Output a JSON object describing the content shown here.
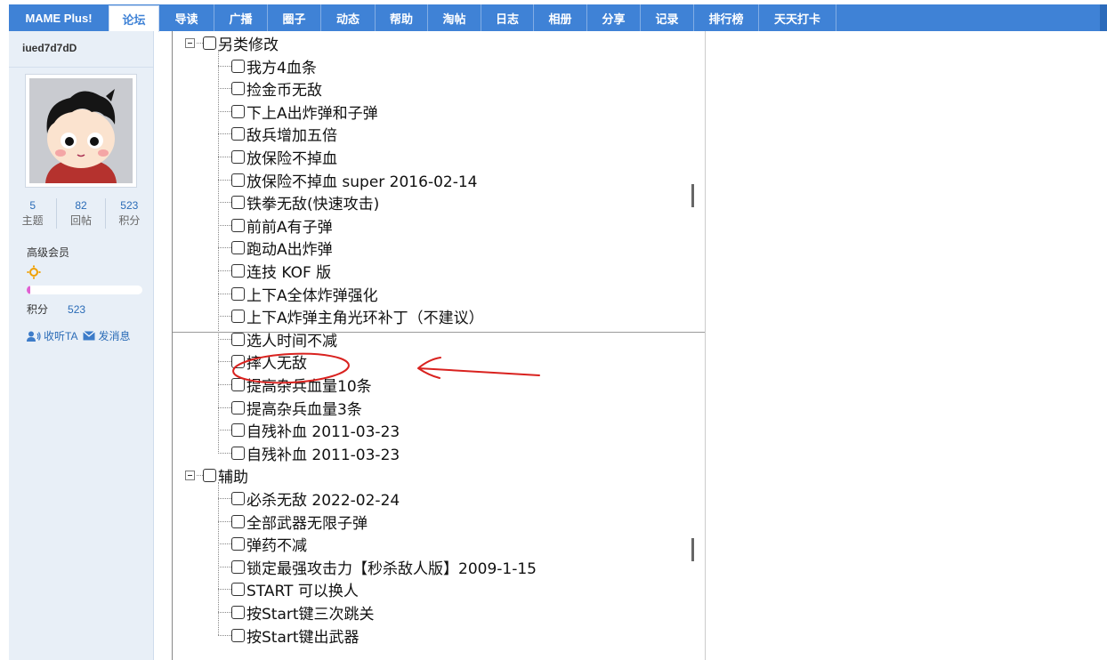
{
  "nav": {
    "brand": "MAME Plus!",
    "tabs": [
      {
        "label": "论坛",
        "active": true
      },
      {
        "label": "导读"
      },
      {
        "label": "广播"
      },
      {
        "label": "圈子"
      },
      {
        "label": "动态"
      },
      {
        "label": "帮助"
      },
      {
        "label": "淘帖"
      },
      {
        "label": "日志"
      },
      {
        "label": "相册"
      },
      {
        "label": "分享"
      },
      {
        "label": "记录"
      },
      {
        "label": "排行榜"
      },
      {
        "label": "天天打卡"
      }
    ]
  },
  "profile": {
    "username": "iued7d7dD",
    "stats": [
      {
        "value": "5",
        "label": "主题"
      },
      {
        "value": "82",
        "label": "回帖"
      },
      {
        "value": "523",
        "label": "积分"
      }
    ],
    "grade": "高级会员",
    "grade_icon": "sun-icon",
    "progress": 0.03,
    "points_label": "积分",
    "points_value": "523",
    "follow_label": "收听TA",
    "message_label": "发消息"
  },
  "tree": {
    "groups": [
      {
        "label": "另类修改",
        "items": [
          "我方4血条",
          "捡金币无敌",
          "下上A出炸弹和子弹",
          "敌兵增加五倍",
          "放保险不掉血",
          "放保险不掉血 super 2016-02-14",
          "铁拳无敌(快速攻击)",
          "前前A有子弹",
          "跑动A出炸弹",
          "连技 KOF 版",
          "上下A全体炸弹强化",
          "上下A炸弹主角光环补丁（不建议）",
          "选人时间不减",
          "摔人无敌",
          "提高杂兵血量10条",
          "提高杂兵血量3条",
          "自残补血 2011-03-23",
          "自残补血 2011-03-23"
        ]
      },
      {
        "label": "辅助",
        "items": [
          "必杀无敌 2022-02-24",
          "全部武器无限子弹",
          "弹药不减",
          "锁定最强攻击力【秒杀敌人版】2009-1-15",
          "START 可以换人",
          "按Start键三次跳关",
          "按Start键出武器"
        ]
      }
    ]
  },
  "annotation": {
    "color": "#d9221f",
    "circled_item": "摔人无敌"
  }
}
